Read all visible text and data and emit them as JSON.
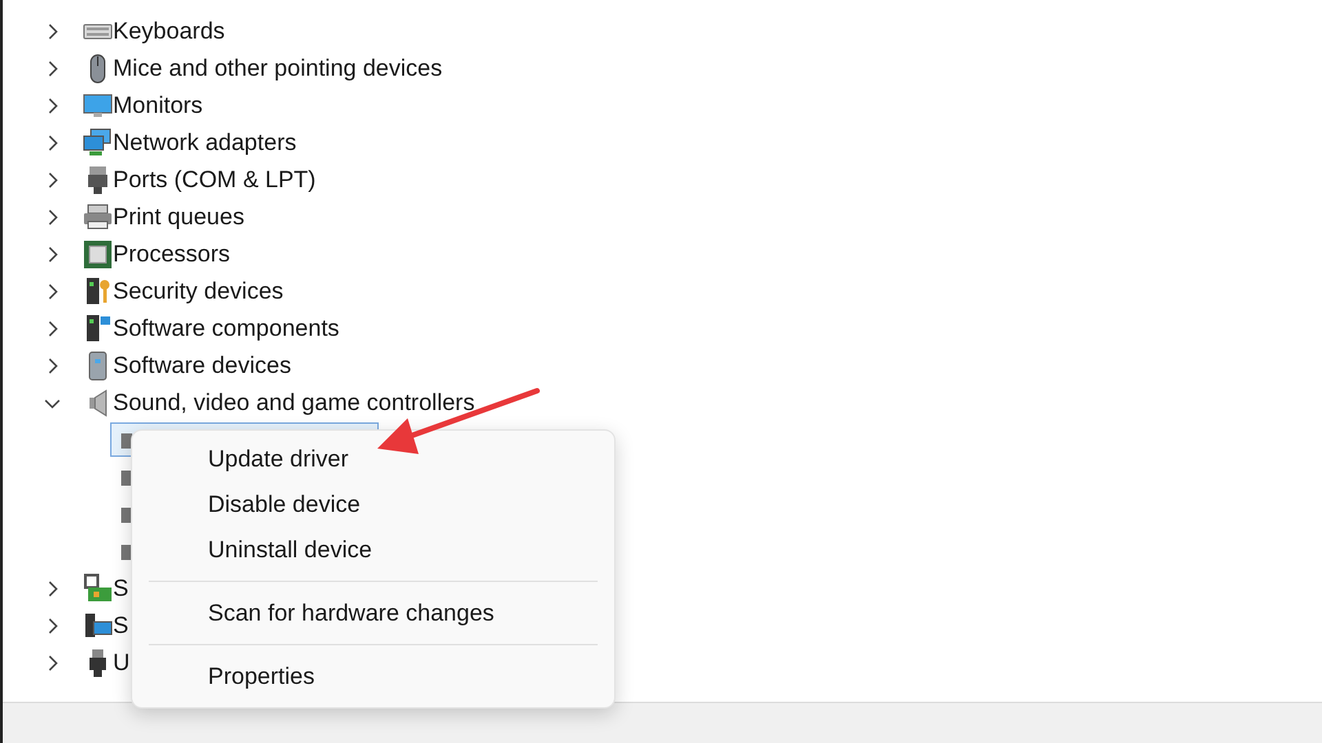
{
  "tree": [
    {
      "label": "Keyboards",
      "expanded": false
    },
    {
      "label": "Mice and other pointing devices",
      "expanded": false
    },
    {
      "label": "Monitors",
      "expanded": false
    },
    {
      "label": "Network adapters",
      "expanded": false
    },
    {
      "label": "Ports (COM & LPT)",
      "expanded": false
    },
    {
      "label": "Print queues",
      "expanded": false
    },
    {
      "label": "Processors",
      "expanded": false
    },
    {
      "label": "Security devices",
      "expanded": false
    },
    {
      "label": "Software components",
      "expanded": false
    },
    {
      "label": "Software devices",
      "expanded": false
    },
    {
      "label": "Sound, video and game controllers",
      "expanded": true,
      "children": [
        {
          "selected": true
        },
        {
          "selected": false
        },
        {
          "selected": false
        },
        {
          "selected": false
        }
      ]
    },
    {
      "label": "S",
      "expanded": false
    },
    {
      "label": "S",
      "expanded": false
    },
    {
      "label": "U",
      "expanded": false
    }
  ],
  "context_menu": {
    "items": [
      {
        "kind": "item",
        "label": "Update driver"
      },
      {
        "kind": "item",
        "label": "Disable device"
      },
      {
        "kind": "item",
        "label": "Uninstall device"
      },
      {
        "kind": "separator"
      },
      {
        "kind": "item",
        "label": "Scan for hardware changes"
      },
      {
        "kind": "separator"
      },
      {
        "kind": "item",
        "label": "Properties"
      }
    ]
  }
}
